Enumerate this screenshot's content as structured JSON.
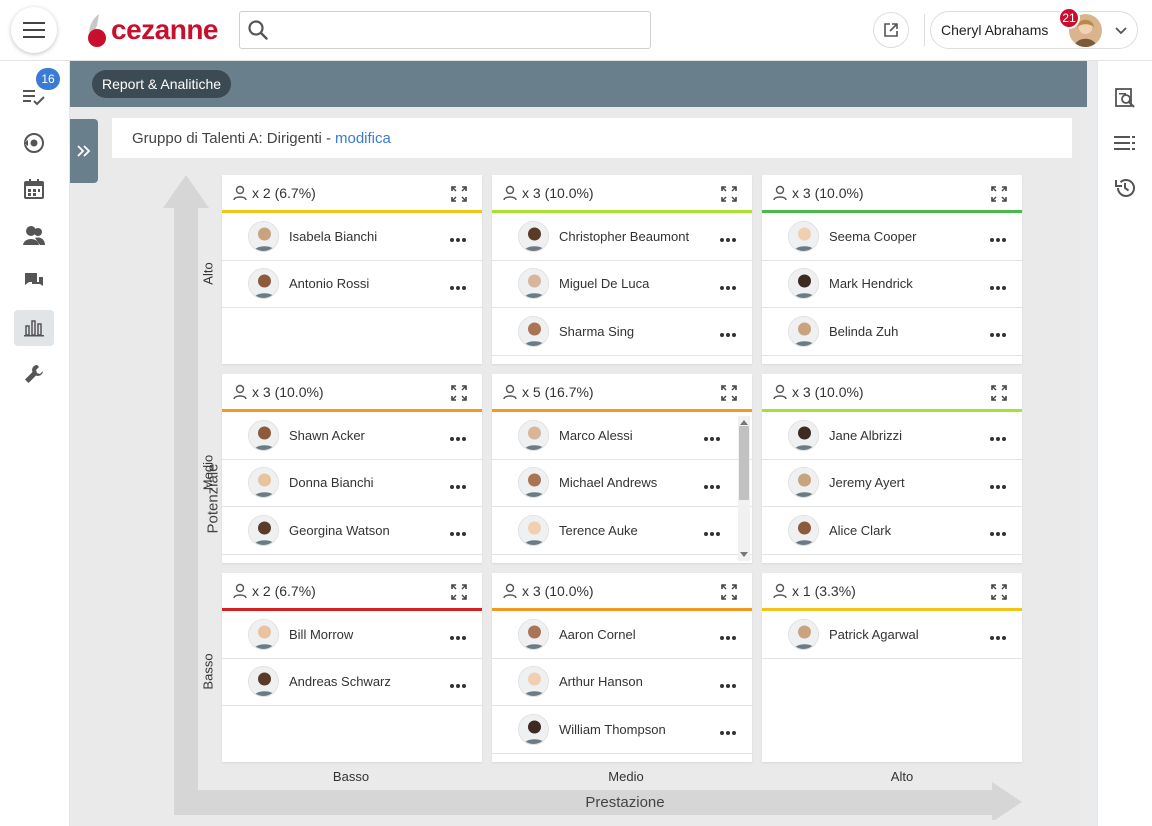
{
  "header": {
    "logo_text": "cezanne",
    "search_placeholder": "",
    "user_name": "Cheryl Abrahams",
    "notifications": "21"
  },
  "leftnav": {
    "tasks_badge": "16",
    "items": [
      "tasks-icon",
      "reviews-icon",
      "calendar-icon",
      "people-icon",
      "chat-icon",
      "reports-icon",
      "tools-icon"
    ],
    "active": "reports-icon"
  },
  "rightnav": {
    "items": [
      "search-document-icon",
      "list-icon",
      "history-icon"
    ]
  },
  "banner": {
    "breadcrumb": "Report & Analitiche"
  },
  "group": {
    "title": "Gruppo di Talenti A: Dirigenti -",
    "edit_link": "modifica"
  },
  "axes": {
    "y_title": "Potenziale",
    "x_title": "Prestazione",
    "y_levels": [
      "Alto",
      "Medio",
      "Basso"
    ],
    "x_levels": [
      "Basso",
      "Medio",
      "Alto"
    ]
  },
  "colors": {
    "yellow": "#f2c318",
    "lime": "#a8e034",
    "green": "#48b94a",
    "orange": "#f29a1f",
    "red": "#d61f1f"
  },
  "cells": [
    {
      "id": "alto-basso",
      "count": "x 2 (6.7%)",
      "color": "#f2c318",
      "people": [
        "Isabela Bianchi",
        "Antonio Rossi"
      ]
    },
    {
      "id": "alto-medio",
      "count": "x 3 (10.0%)",
      "color": "#a8e034",
      "people": [
        "Christopher Beaumont",
        "Miguel De Luca",
        "Sharma Sing"
      ]
    },
    {
      "id": "alto-alto",
      "count": "x 3 (10.0%)",
      "color": "#48b94a",
      "people": [
        "Seema Cooper",
        "Mark Hendrick",
        "Belinda Zuh"
      ]
    },
    {
      "id": "medio-basso",
      "count": "x 3 (10.0%)",
      "color": "#f29a1f",
      "people": [
        "Shawn Acker",
        "Donna Bianchi",
        "Georgina Watson"
      ]
    },
    {
      "id": "medio-medio",
      "count": "x 5 (16.7%)",
      "color": "#f29a1f",
      "people": [
        "Marco Alessi",
        "Michael Andrews",
        "Terence Auke"
      ]
    },
    {
      "id": "medio-alto",
      "count": "x 3 (10.0%)",
      "color": "#a8e034",
      "people": [
        "Jane Albrizzi",
        "Jeremy Ayert",
        "Alice Clark"
      ]
    },
    {
      "id": "basso-basso",
      "count": "x 2 (6.7%)",
      "color": "#d61f1f",
      "people": [
        "Bill Morrow",
        "Andreas Schwarz"
      ]
    },
    {
      "id": "basso-medio",
      "count": "x 3 (10.0%)",
      "color": "#f29a1f",
      "people": [
        "Aaron Cornel",
        "Arthur Hanson",
        "William Thompson"
      ]
    },
    {
      "id": "basso-alto",
      "count": "x 1 (3.3%)",
      "color": "#f2c318",
      "people": [
        "Patrick Agarwal"
      ]
    }
  ]
}
